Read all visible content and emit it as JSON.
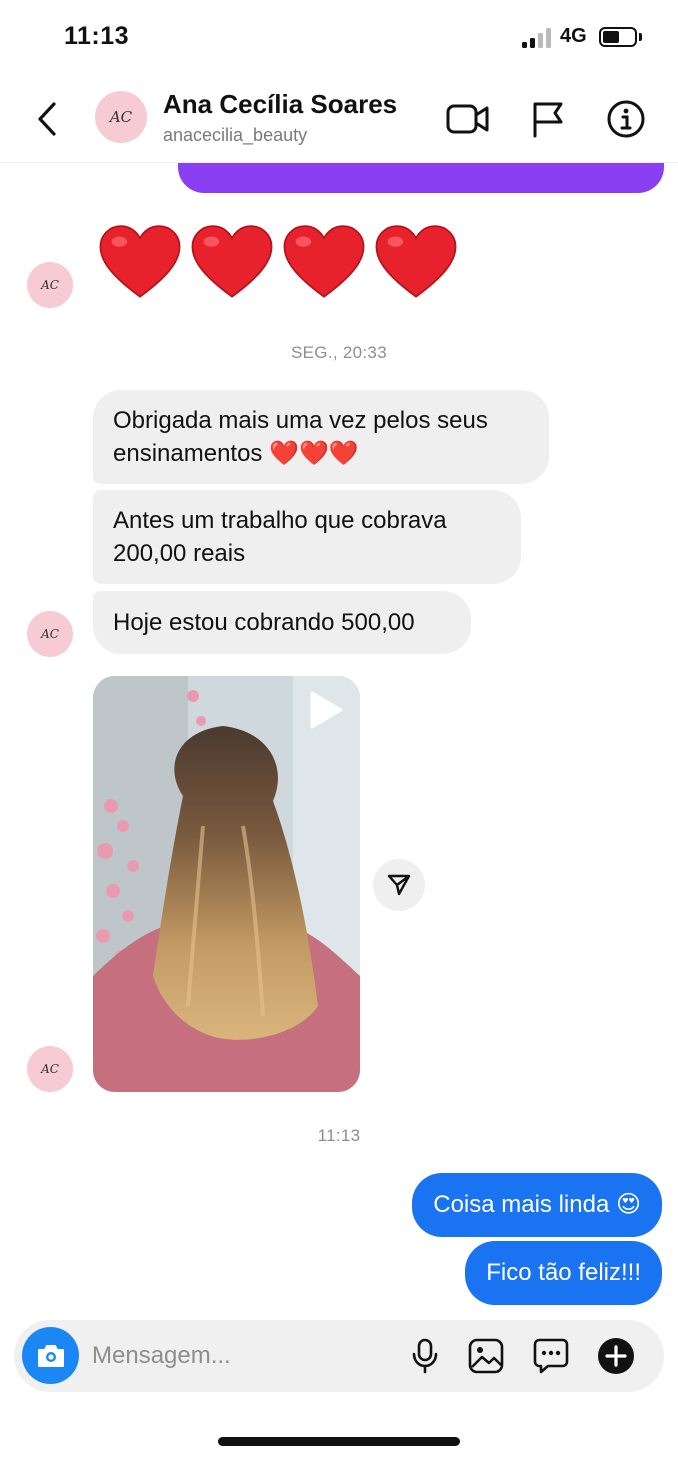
{
  "status_bar": {
    "time": "11:13",
    "network": "4G"
  },
  "header": {
    "name": "Ana Cecília Soares",
    "username": "anacecilia_beauty",
    "avatar_text": "AC"
  },
  "messages": {
    "hearts": [
      "❤️",
      "❤️",
      "❤️",
      "❤️"
    ],
    "timestamp_1": "SEG., 20:33",
    "in_1": "Obrigada mais uma vez pelos seus ensinamentos ❤️❤️❤️",
    "in_2": "Antes um trabalho que cobrava 200,00 reais",
    "in_3": "Hoje estou cobrando 500,00",
    "timestamp_2": "11:13",
    "out_1": "Coisa mais linda 😍",
    "out_2": "Fico tão feliz!!!"
  },
  "composer": {
    "placeholder": "Mensagem..."
  },
  "colors": {
    "outgoing_bubble": "#1a73f1",
    "incoming_bubble": "#efefef",
    "audio_bubble": "#8a3ff3",
    "camera_button": "#1a87f5",
    "avatar_bg": "#f6cbd3"
  },
  "icons": {
    "back": "chevron-left-icon",
    "video_call": "video-camera-icon",
    "report": "flag-icon",
    "info": "info-icon",
    "play": "play-icon",
    "share": "paper-plane-icon",
    "camera": "camera-icon",
    "mic": "microphone-icon",
    "gallery": "image-icon",
    "sticker": "chat-bubble-icon",
    "add": "plus-circle-icon"
  }
}
